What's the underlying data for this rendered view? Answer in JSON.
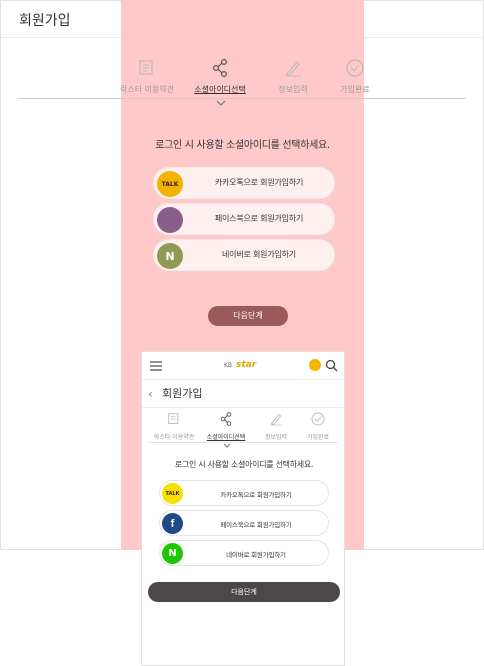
{
  "page": {
    "title": "회원가입"
  },
  "steps": [
    {
      "label": "락스타 이용약관",
      "icon": "document-icon",
      "active": false
    },
    {
      "label": "소셜아이디선택",
      "icon": "share-icon",
      "active": true
    },
    {
      "label": "정보입력",
      "icon": "pen-icon",
      "active": false
    },
    {
      "label": "가입완료",
      "icon": "check-circle-icon",
      "active": false
    }
  ],
  "headline": "로그인 시 사용할 소셜아이디를 선택하세요.",
  "sns_buttons": [
    {
      "label": "카카오톡으로 회원가입하기",
      "badge_text": "TALK",
      "icon": "kakao-talk-icon",
      "badge_color": "#f2b400",
      "badge_text_color": "#3c1e1e"
    },
    {
      "label": "페이스북으로 회원가입하기",
      "badge_text": "",
      "icon": "facebook-icon",
      "badge_color": "#8a5e8a",
      "badge_text_color": "#ffffff"
    },
    {
      "label": "네이버로 회원가입하기",
      "badge_text": "N",
      "icon": "naver-icon",
      "badge_color": "#8f9a55",
      "badge_text_color": "#ffffff"
    }
  ],
  "next_button": "다음단계",
  "mobile": {
    "logo_prefix": "KB",
    "logo_brand": "star",
    "title": "회원가입",
    "steps": [
      {
        "label": "락스타 이용약관",
        "icon": "document-icon",
        "active": false
      },
      {
        "label": "소셜아이디선택",
        "icon": "share-icon",
        "active": true
      },
      {
        "label": "정보입력",
        "icon": "pen-icon",
        "active": false
      },
      {
        "label": "가입완료",
        "icon": "check-circle-icon",
        "active": false
      }
    ],
    "headline": "로그인 시 사용할 소셜아이디를 선택하세요.",
    "sns_buttons": [
      {
        "label": "카카오톡으로 회원가입하기",
        "badge_text": "TALK",
        "icon": "kakao-talk-icon",
        "badge_color": "#f7e100",
        "badge_text_color": "#3c1e1e"
      },
      {
        "label": "페이스북으로 회원가입하기",
        "badge_text": "f",
        "icon": "facebook-icon",
        "badge_color": "#1f4a86",
        "badge_text_color": "#ffffff"
      },
      {
        "label": "네이버로 회원가입하기",
        "badge_text": "N",
        "icon": "naver-icon",
        "badge_color": "#1ec800",
        "badge_text_color": "#ffffff"
      }
    ],
    "next_button": "다음단계"
  },
  "colors": {
    "highlight": "#ffc6c6",
    "desktop_next": "#9a5a5a",
    "mobile_next": "#4d4847",
    "brand_yellow": "#f5b400"
  }
}
